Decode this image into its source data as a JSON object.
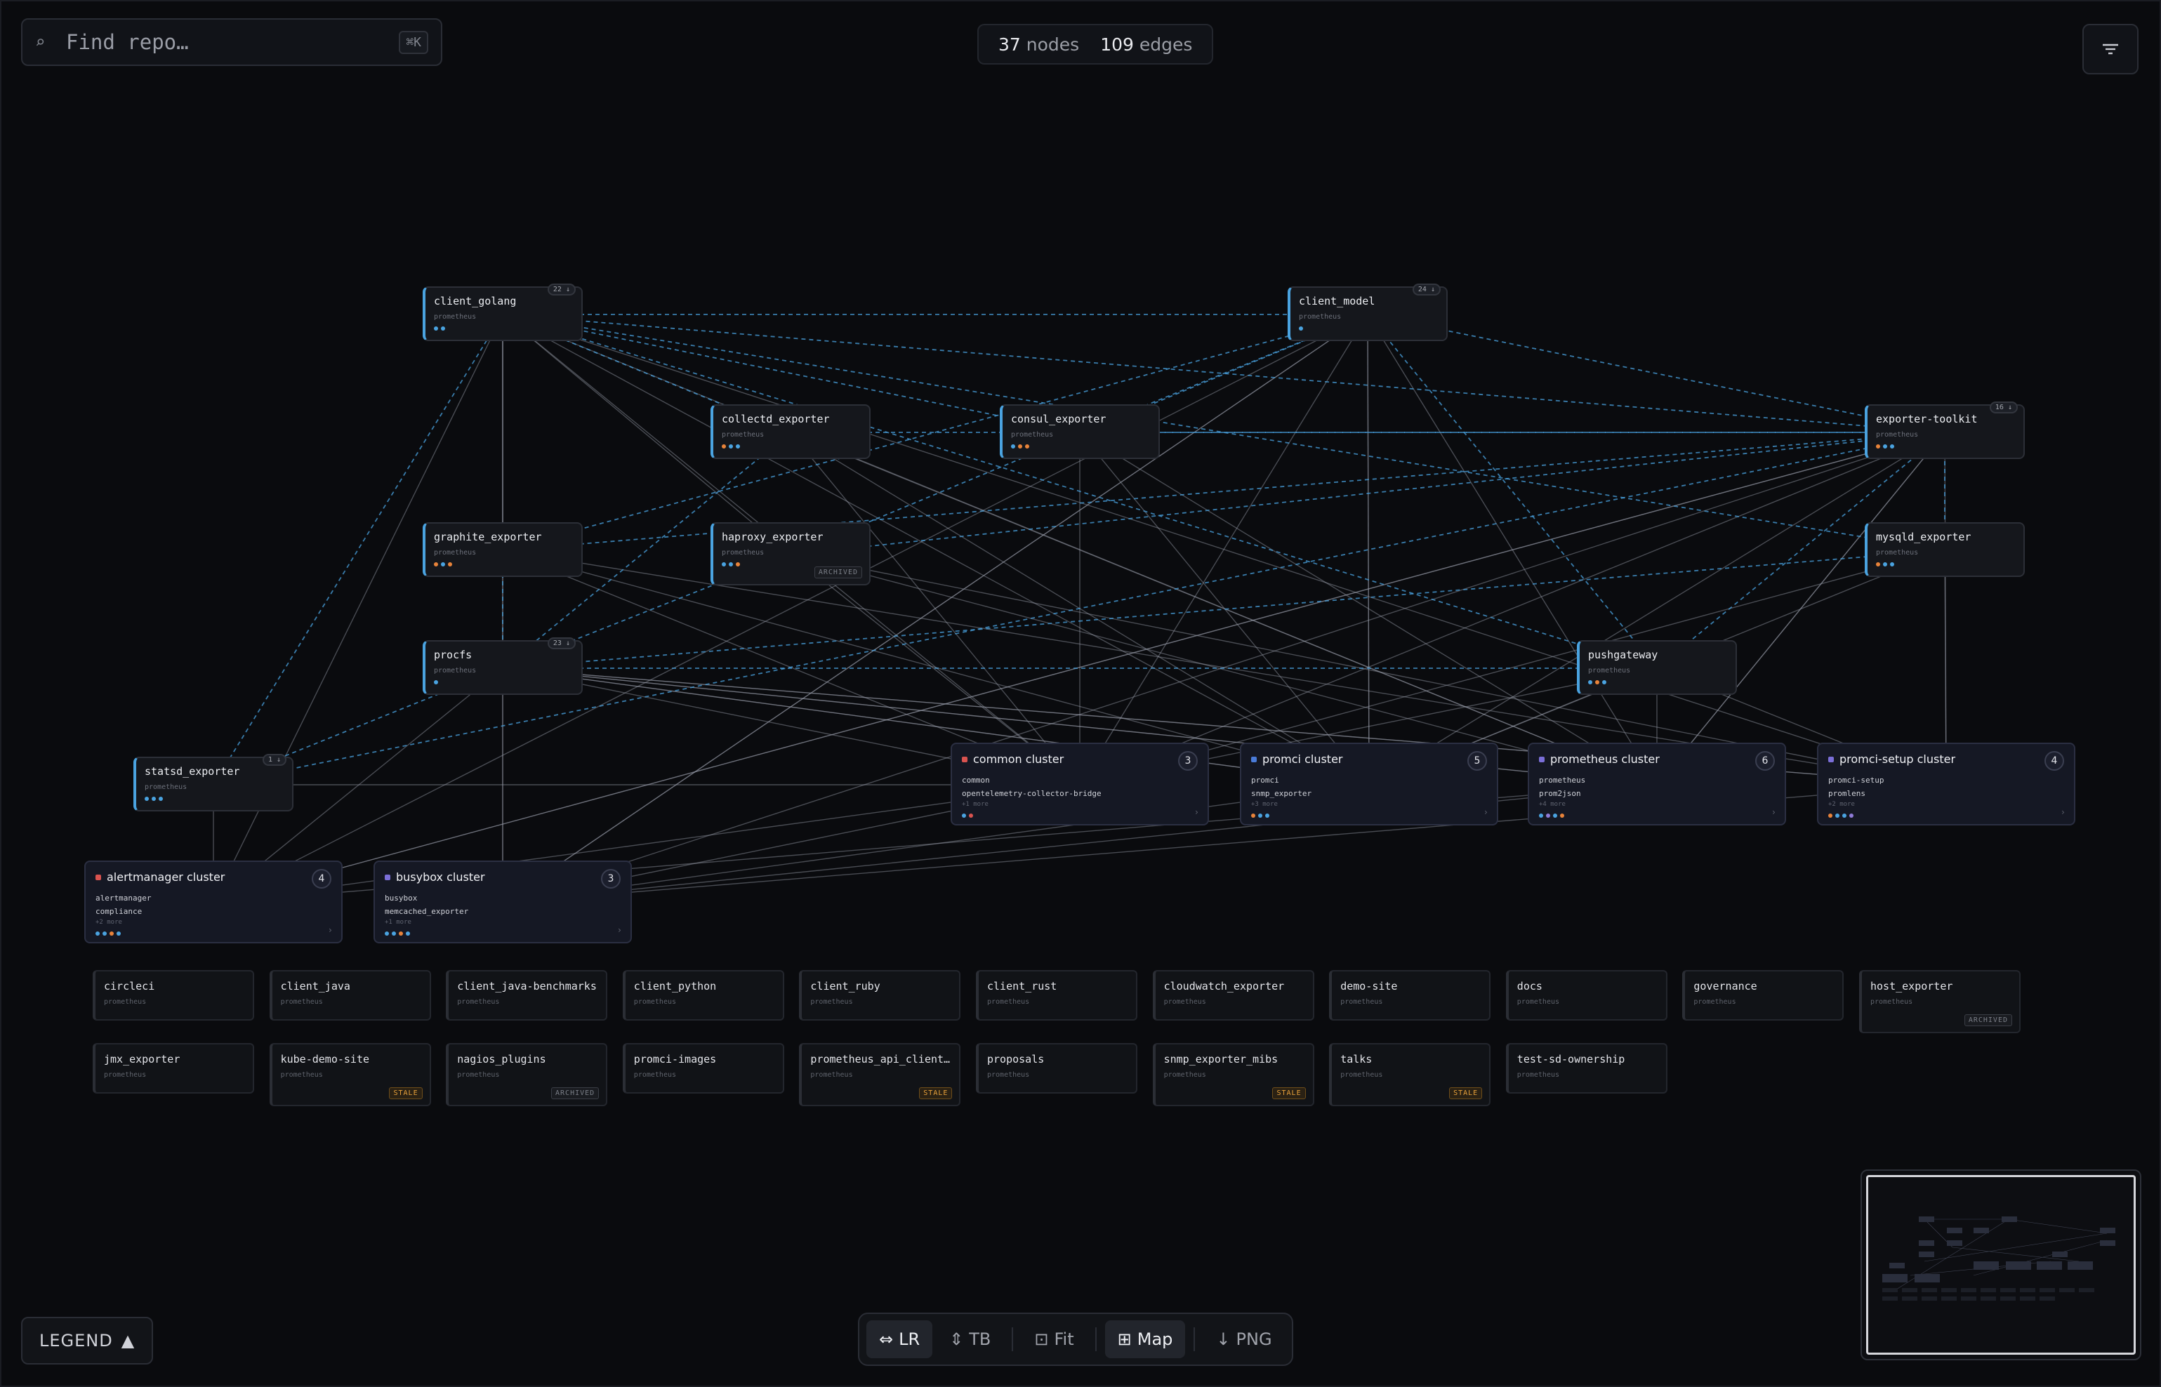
{
  "search": {
    "placeholder": "Find repo…",
    "shortcut": "⌘K"
  },
  "stats": {
    "nodes_num": "37",
    "nodes_label": "nodes",
    "edges_num": "109",
    "edges_label": "edges"
  },
  "colors": {
    "accent": "#4aa3e0",
    "dot_blue": "#4aa3e0",
    "dot_orange": "#e8833a",
    "dot_red": "#d9534f",
    "dot_purple": "#8f7bd8",
    "stale": "#e9a23b"
  },
  "nodes": [
    {
      "id": "client_golang",
      "name": "client_golang",
      "org": "prometheus",
      "count": "22 ↓",
      "dots": [
        "blue",
        "blue"
      ]
    },
    {
      "id": "client_model",
      "name": "client_model",
      "org": "prometheus",
      "count": "24 ↓",
      "dots": [
        "blue"
      ]
    },
    {
      "id": "collectd_exporter",
      "name": "collectd_exporter",
      "org": "prometheus",
      "dots": [
        "orange",
        "blue",
        "blue"
      ]
    },
    {
      "id": "consul_exporter",
      "name": "consul_exporter",
      "org": "prometheus",
      "dots": [
        "blue",
        "orange",
        "orange"
      ]
    },
    {
      "id": "exporter_toolkit",
      "name": "exporter-toolkit",
      "org": "prometheus",
      "count": "16 ↓",
      "dots": [
        "orange",
        "blue",
        "blue"
      ]
    },
    {
      "id": "graphite_exporter",
      "name": "graphite_exporter",
      "org": "prometheus",
      "dots": [
        "orange",
        "blue",
        "orange"
      ]
    },
    {
      "id": "haproxy_exporter",
      "name": "haproxy_exporter",
      "org": "prometheus",
      "badge": "ARCHIVED",
      "dots": [
        "blue",
        "blue",
        "orange"
      ]
    },
    {
      "id": "mysqld_exporter",
      "name": "mysqld_exporter",
      "org": "prometheus",
      "dots": [
        "orange",
        "blue",
        "blue"
      ]
    },
    {
      "id": "procfs",
      "name": "procfs",
      "org": "prometheus",
      "count": "23 ↓",
      "dots": [
        "blue"
      ]
    },
    {
      "id": "pushgateway",
      "name": "pushgateway",
      "org": "prometheus",
      "dots": [
        "blue",
        "orange",
        "blue"
      ]
    },
    {
      "id": "statsd_exporter",
      "name": "statsd_exporter",
      "org": "prometheus",
      "count": "1 ↓",
      "dots": [
        "blue",
        "blue",
        "blue"
      ]
    }
  ],
  "clusters": [
    {
      "id": "common",
      "title": "common cluster",
      "num": "3",
      "color": "#d9534f",
      "members": [
        "common",
        "opentelemetry-collector-bridge"
      ],
      "more": "+1 more",
      "dots": [
        "blue",
        "red"
      ]
    },
    {
      "id": "promci",
      "title": "promci cluster",
      "num": "5",
      "color": "#4a7bd8",
      "members": [
        "promci",
        "snmp_exporter"
      ],
      "more": "+3 more",
      "dots": [
        "orange",
        "blue",
        "blue"
      ]
    },
    {
      "id": "prometheus",
      "title": "prometheus cluster",
      "num": "6",
      "color": "#7b6fd8",
      "members": [
        "prometheus",
        "prom2json"
      ],
      "more": "+4 more",
      "dots": [
        "blue",
        "purple",
        "blue",
        "orange"
      ]
    },
    {
      "id": "promci_setup",
      "title": "promci-setup cluster",
      "num": "4",
      "color": "#7b6fd8",
      "members": [
        "promci-setup",
        "promlens"
      ],
      "more": "+2 more",
      "dots": [
        "orange",
        "blue",
        "blue",
        "purple"
      ]
    },
    {
      "id": "alertmanager",
      "title": "alertmanager cluster",
      "num": "4",
      "color": "#d9534f",
      "members": [
        "alertmanager",
        "compliance"
      ],
      "more": "+2 more",
      "dots": [
        "blue",
        "blue",
        "orange",
        "blue"
      ]
    },
    {
      "id": "busybox",
      "title": "busybox cluster",
      "num": "3",
      "color": "#7b6fd8",
      "members": [
        "busybox",
        "memcached_exporter"
      ],
      "more": "+1 more",
      "dots": [
        "blue",
        "blue",
        "orange",
        "blue"
      ]
    }
  ],
  "isolated": [
    {
      "name": "circleci",
      "org": "prometheus"
    },
    {
      "name": "client_java",
      "org": "prometheus"
    },
    {
      "name": "client_java-benchmarks",
      "org": "prometheus"
    },
    {
      "name": "client_python",
      "org": "prometheus"
    },
    {
      "name": "client_ruby",
      "org": "prometheus"
    },
    {
      "name": "client_rust",
      "org": "prometheus"
    },
    {
      "name": "cloudwatch_exporter",
      "org": "prometheus"
    },
    {
      "name": "demo-site",
      "org": "prometheus"
    },
    {
      "name": "docs",
      "org": "prometheus"
    },
    {
      "name": "governance",
      "org": "prometheus"
    },
    {
      "name": "host_exporter",
      "org": "prometheus",
      "badge": "ARCHIVED"
    },
    {
      "name": "jmx_exporter",
      "org": "prometheus"
    },
    {
      "name": "kube-demo-site",
      "org": "prometheus",
      "badge": "STALE"
    },
    {
      "name": "nagios_plugins",
      "org": "prometheus",
      "badge": "ARCHIVED"
    },
    {
      "name": "promci-images",
      "org": "prometheus"
    },
    {
      "name": "prometheus_api_client…",
      "org": "prometheus",
      "badge": "STALE"
    },
    {
      "name": "proposals",
      "org": "prometheus"
    },
    {
      "name": "snmp_exporter_mibs",
      "org": "prometheus",
      "badge": "STALE"
    },
    {
      "name": "talks",
      "org": "prometheus",
      "badge": "STALE"
    },
    {
      "name": "test-sd-ownership",
      "org": "prometheus"
    }
  ],
  "legend": {
    "label": "LEGEND",
    "arrow": "▲"
  },
  "toolbar": {
    "lr": {
      "icon": "⇔",
      "label": "LR"
    },
    "tb": {
      "icon": "⇕",
      "label": "TB"
    },
    "fit": {
      "icon": "⊡",
      "label": "Fit"
    },
    "map": {
      "icon": "⊞",
      "label": "Map"
    },
    "png": {
      "icon": "↓",
      "label": "PNG"
    }
  }
}
